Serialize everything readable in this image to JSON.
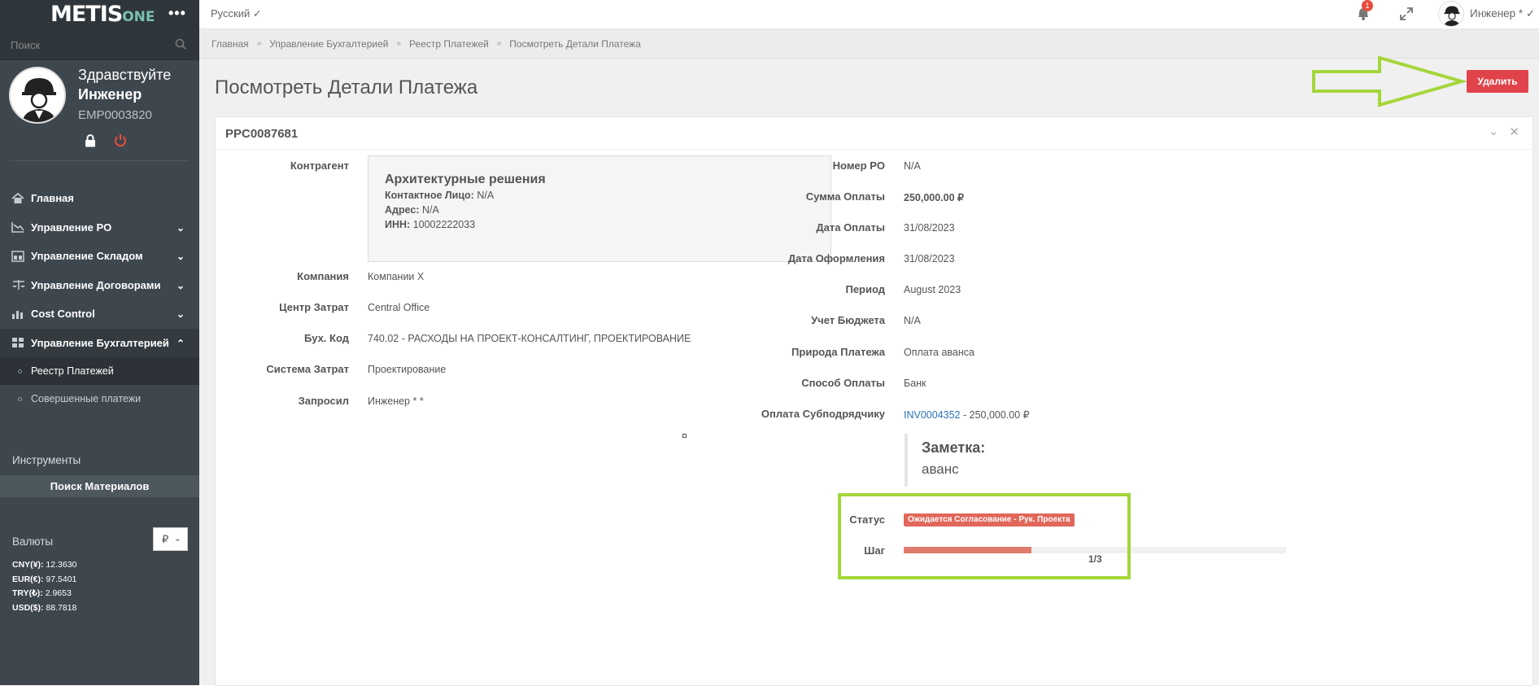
{
  "app": {
    "logo_main": "METIS",
    "logo_sub": "ONE",
    "menu_dots": "•••"
  },
  "search": {
    "placeholder": "Поиск"
  },
  "profile": {
    "greeting": "Здравствуйте",
    "name": "Инженер",
    "emp_id": "EMP0003820"
  },
  "nav": {
    "items": [
      {
        "label": "Главная",
        "icon": "home-icon"
      },
      {
        "label": "Управление PO",
        "icon": "chart-icon"
      },
      {
        "label": "Управление Складом",
        "icon": "warehouse-icon"
      },
      {
        "label": "Управление Договорами",
        "icon": "scale-icon"
      },
      {
        "label": "Cost Control",
        "icon": "bar-chart-icon"
      },
      {
        "label": "Управление Бухгалтерией",
        "icon": "grid-icon"
      }
    ],
    "sub_items": [
      {
        "label": "Реестр Платежей"
      },
      {
        "label": "Совершенные платежи"
      }
    ]
  },
  "tools": {
    "title": "Инструменты",
    "button": "Поиск Материалов"
  },
  "currency": {
    "title": "Валюты",
    "selected": "₽",
    "rates": [
      {
        "code": "CNY(¥):",
        "value": "12.3630"
      },
      {
        "code": "EUR(€):",
        "value": "97.5401"
      },
      {
        "code": "TRY(₺):",
        "value": "2.9653"
      },
      {
        "code": "USD($):",
        "value": "88.7818"
      }
    ]
  },
  "topbar": {
    "language": "Русский ✓",
    "notif_count": "1",
    "user": "Инженер * ✓"
  },
  "breadcrumb": [
    "Главная",
    "Управление Бухгалтерией",
    "Реестр Платежей",
    "Посмотреть Детали Платежа"
  ],
  "page": {
    "title": "Посмотреть Детали Платежа",
    "delete_label": "Удалить"
  },
  "panel": {
    "id": "PPC0087681",
    "left": {
      "counterparty_label": "Контрагент",
      "counterparty": {
        "name": "Архитектурные решения",
        "contact_label": "Контактное Лицо:",
        "contact": "N/A",
        "address_label": "Адрес:",
        "address": "N/A",
        "inn_label": "ИНН:",
        "inn": "10002222033"
      },
      "fields": [
        {
          "label": "Компания",
          "value": "Компании X"
        },
        {
          "label": "Центр Затрат",
          "value": "Central Office"
        },
        {
          "label": "Бух. Код",
          "value": "740.02 - РАСХОДЫ НА ПРОЕКТ-КОНСАЛТИНГ, ПРОЕКТИРОВАНИЕ"
        },
        {
          "label": "Система Затрат",
          "value": "Проектирование"
        },
        {
          "label": "Запросил",
          "value": "Инженер * *"
        }
      ]
    },
    "right": {
      "fields": [
        {
          "label": "Номер PO",
          "value": "N/A"
        },
        {
          "label": "Сумма Оплаты",
          "value": "250,000.00 ₽"
        },
        {
          "label": "Дата Оплаты",
          "value": "31/08/2023"
        },
        {
          "label": "Дата Оформления",
          "value": "31/08/2023"
        },
        {
          "label": "Период",
          "value": "August 2023"
        },
        {
          "label": "Учет Бюджета",
          "value": "N/A"
        },
        {
          "label": "Природа Платежа",
          "value": "Оплата аванса"
        },
        {
          "label": "Способ Оплаты",
          "value": "Банк"
        }
      ],
      "subcontractor_label": "Оплата Субподрядчику",
      "subcontractor_link": "INV0004352",
      "subcontractor_rest": " - 250,000.00 ₽",
      "note_title": "Заметка:",
      "note_text": "аванс",
      "status_label": "Статус",
      "status_value": "Ожидается Согласование - Рук. Проекта",
      "step_label": "Шаг",
      "step_value": "1/3",
      "step_progress": 0.333
    }
  },
  "colors": {
    "sidebar": "#3e474e",
    "danger": "#e1434a",
    "highlight": "#a4d63a",
    "status": "#e0675a"
  }
}
